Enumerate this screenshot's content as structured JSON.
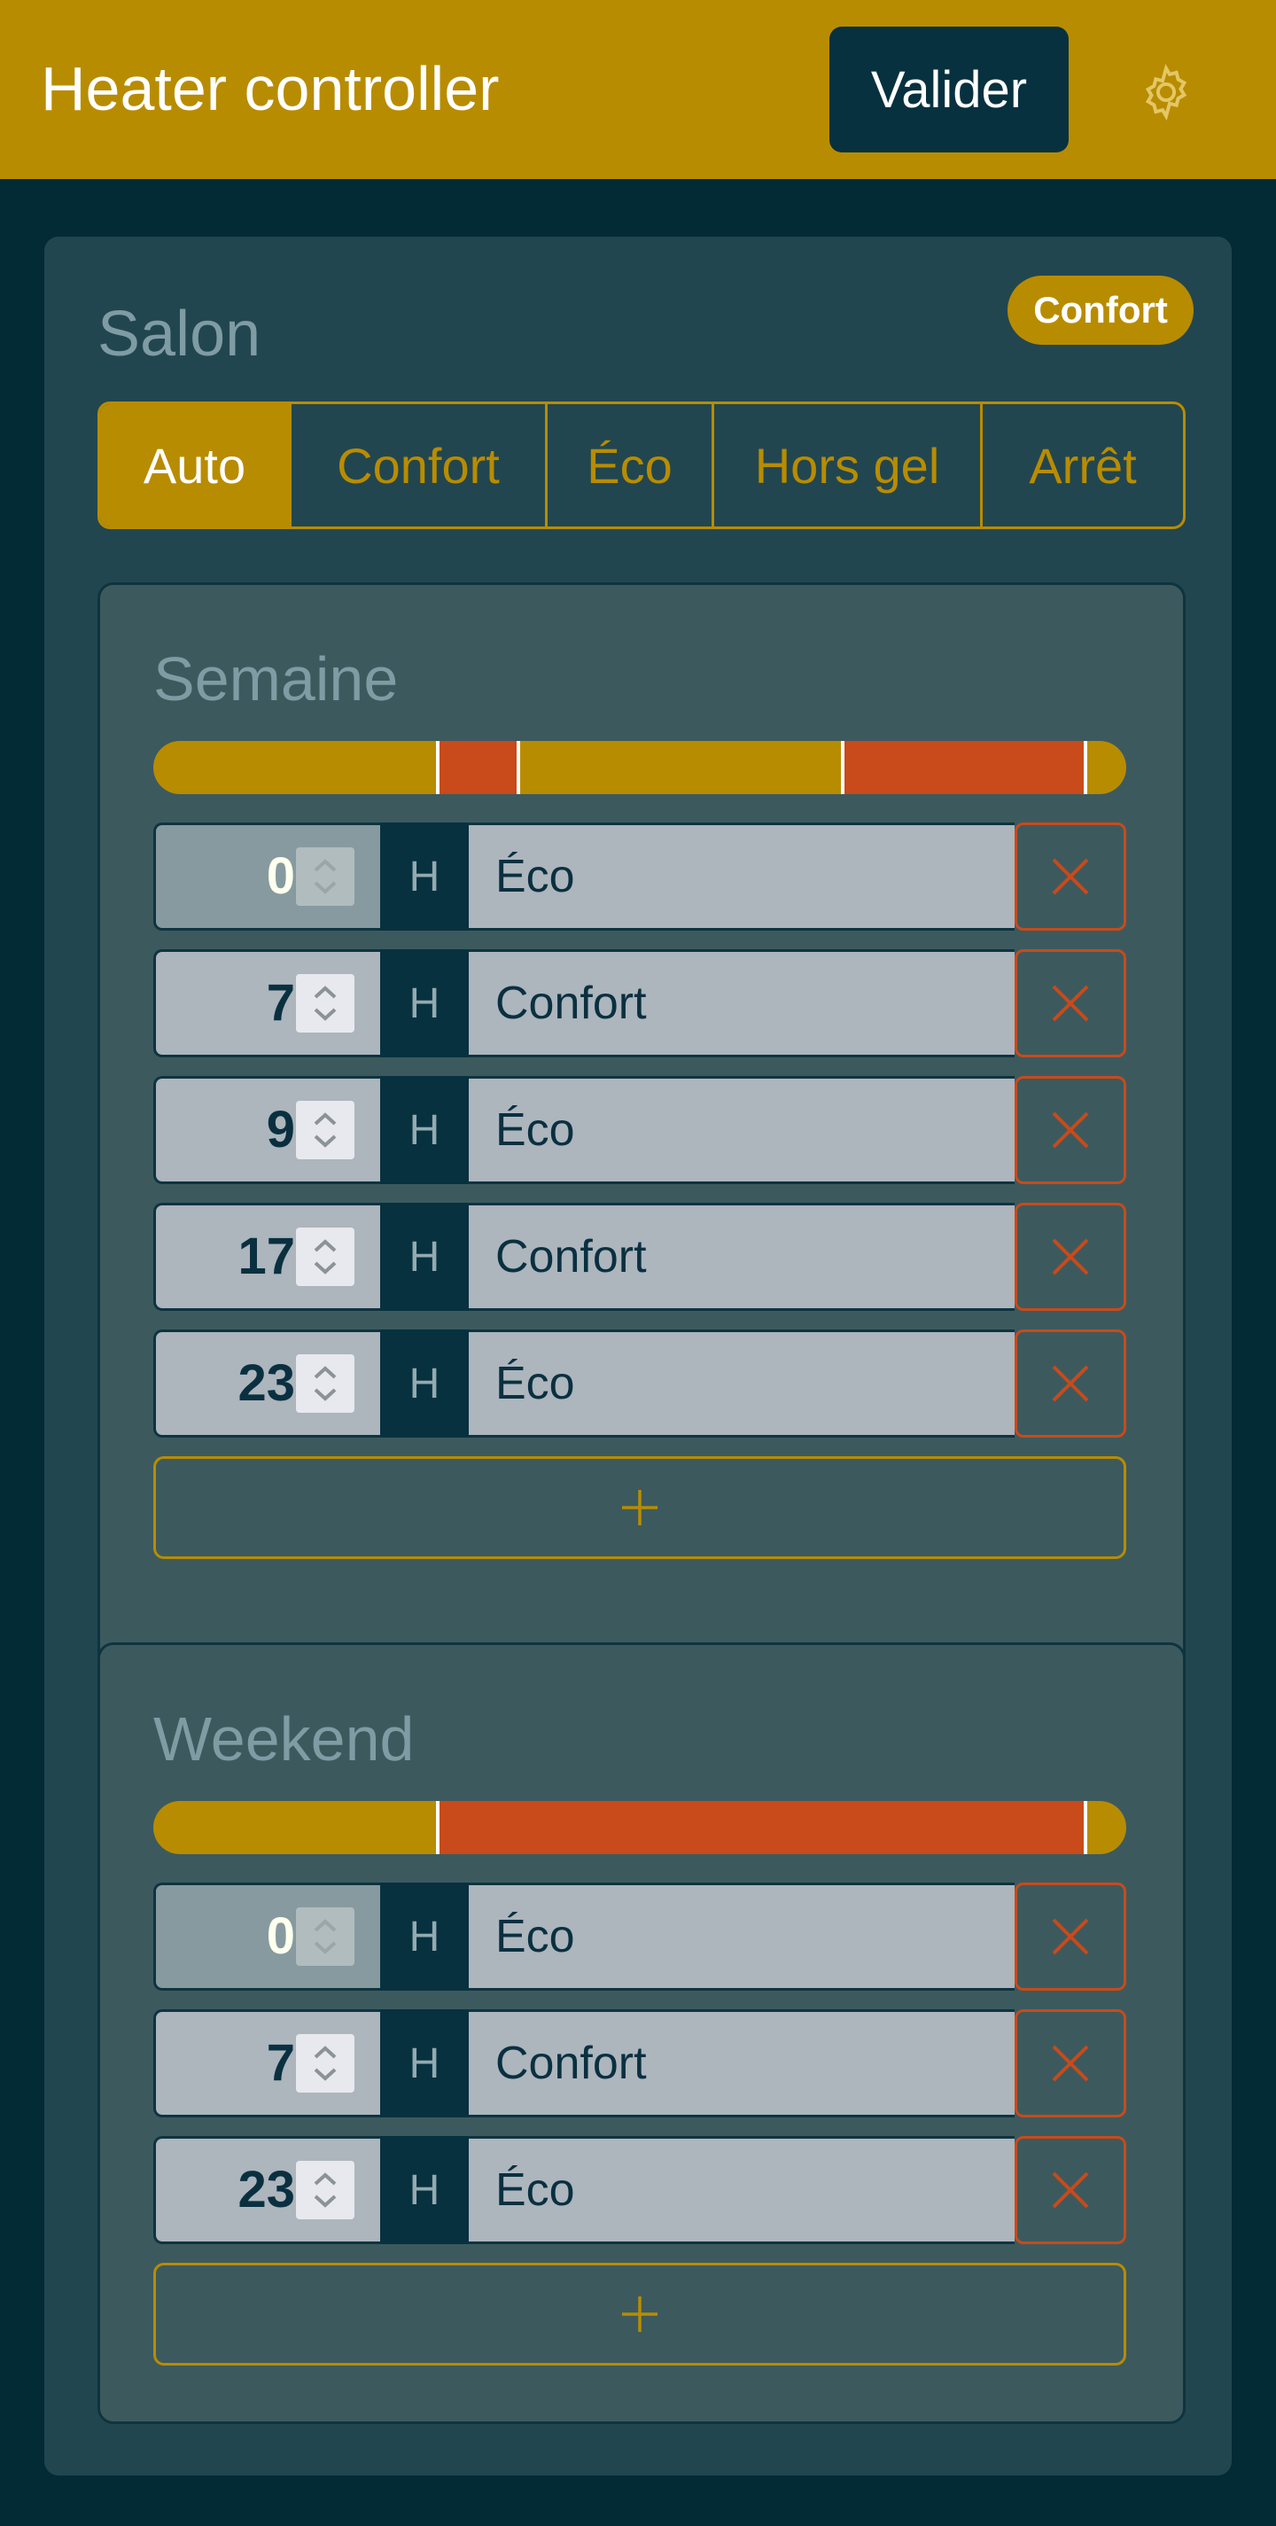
{
  "header": {
    "title": "Heater controller",
    "validate_label": "Valider",
    "settings_icon": "gear-icon"
  },
  "room": {
    "name": "Salon",
    "current_mode_badge": "Confort",
    "modes": [
      "Auto",
      "Confort",
      "Éco",
      "Hors gel",
      "Arrêt"
    ],
    "selected_mode": "Auto"
  },
  "schedules": [
    {
      "title": "Semaine",
      "entries": [
        {
          "hour": "0",
          "unit": "H",
          "mode": "Éco"
        },
        {
          "hour": "7",
          "unit": "H",
          "mode": "Confort"
        },
        {
          "hour": "9",
          "unit": "H",
          "mode": "Éco"
        },
        {
          "hour": "17",
          "unit": "H",
          "mode": "Confort"
        },
        {
          "hour": "23",
          "unit": "H",
          "mode": "Éco"
        }
      ]
    },
    {
      "title": "Weekend",
      "entries": [
        {
          "hour": "0",
          "unit": "H",
          "mode": "Éco"
        },
        {
          "hour": "7",
          "unit": "H",
          "mode": "Confort"
        },
        {
          "hour": "23",
          "unit": "H",
          "mode": "Éco"
        }
      ]
    }
  ],
  "colors": {
    "accent": "#b88c00",
    "comfort": "#c94a1a",
    "eco": "#b88c00",
    "background": "#032b36"
  }
}
